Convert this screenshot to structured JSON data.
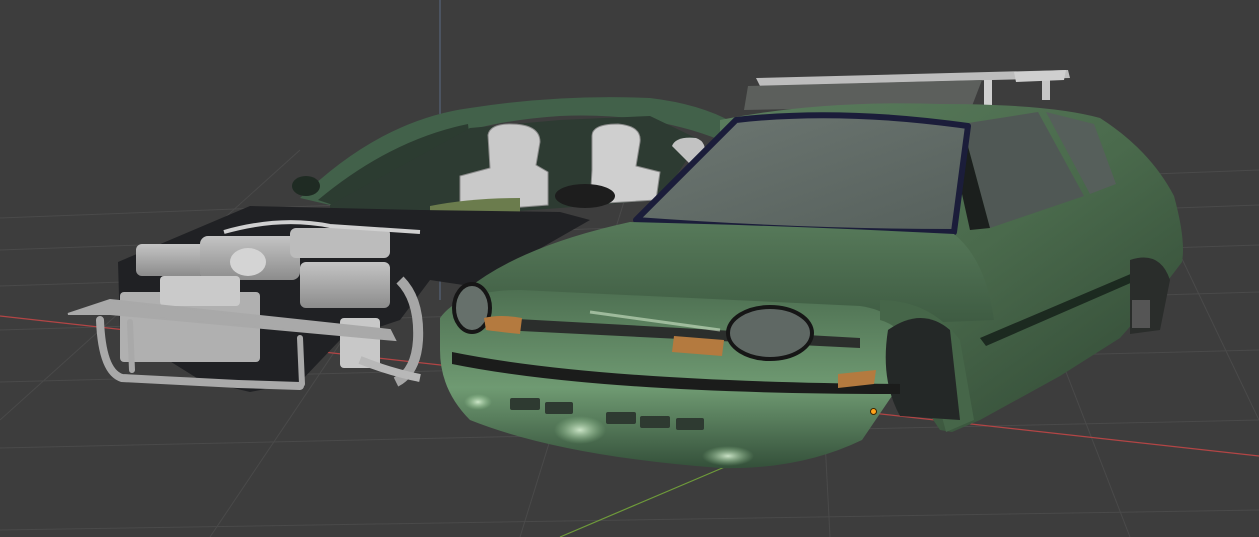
{
  "viewport": {
    "background": "#3d3d3d",
    "grid_color": "#4a4a4a",
    "x_axis_color": "#b34545",
    "y_axis_color": "#6e9a3a",
    "z_axis_color": "#5a6a85",
    "origin_color": "#ffa31a"
  },
  "scene": {
    "objects": [
      {
        "name": "car-body-finished",
        "material_color": "#4a6a4c"
      },
      {
        "name": "car-body-cutaway",
        "material_color": "#3f5e46"
      },
      {
        "name": "engine-assembly",
        "material_color": "#b4b4b4"
      },
      {
        "name": "roof-rack",
        "material_color": "#bdbdbd"
      }
    ]
  }
}
